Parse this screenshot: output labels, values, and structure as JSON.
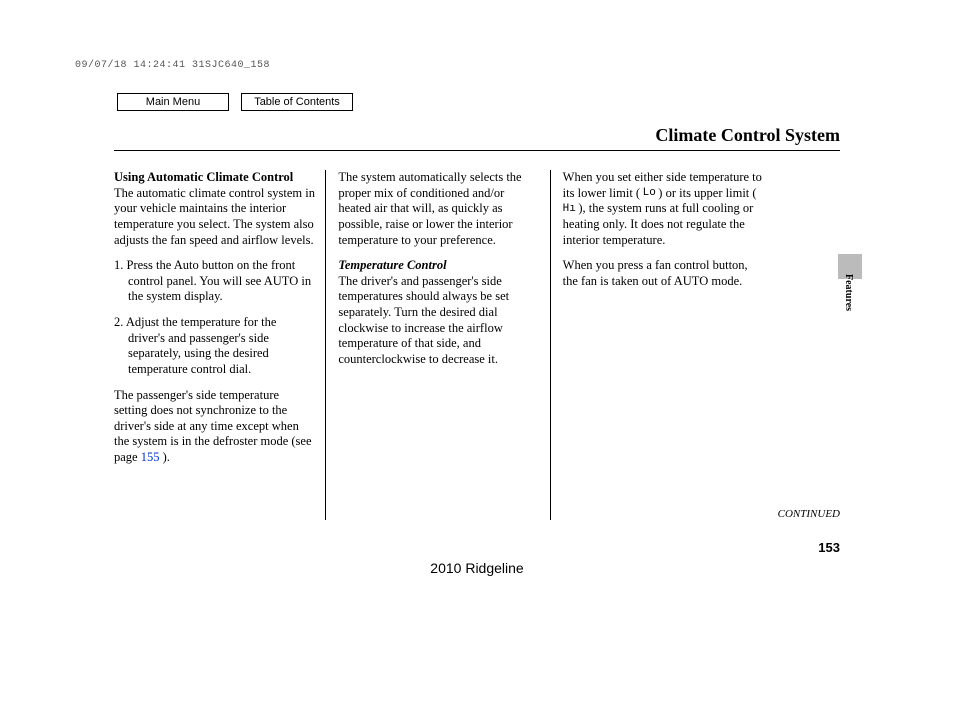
{
  "header_stamp": "09/07/18 14:24:41 31SJC640_158",
  "nav": {
    "main_menu": "Main Menu",
    "toc": "Table of Contents"
  },
  "title": "Climate Control System",
  "col1": {
    "lead_bold": "Using Automatic Climate Control",
    "lead_text": "The automatic climate control system in your vehicle maintains the interior temperature you select. The system also adjusts the fan speed and airflow levels.",
    "step1_prefix": "1. ",
    "step1": "Press the Auto button on the front control panel. You will see AUTO in the system display.",
    "step2_prefix": "2. ",
    "step2": "Adjust the temperature for the driver's and passenger's side separately, using the desired temperature control dial.",
    "para2a": "The passenger's side temperature setting does not synchronize to the driver's side at any time except when the system is in the defroster mode (see page ",
    "para2_link": "155",
    "para2b": " )."
  },
  "col2": {
    "para1": "The system automatically selects the proper mix of conditioned and/or heated air that will, as quickly as possible, raise or lower the interior temperature to your preference.",
    "sub_italic": "Temperature Control",
    "para2": "The driver's and passenger's side temperatures should always be set separately. Turn the desired dial clockwise to increase the airflow temperature of that side, and counterclockwise to decrease it."
  },
  "col3": {
    "p1a": "When you set either side temperature to its lower limit ( ",
    "lo_glyph": "Lo",
    "p1b": " ) or its upper limit ( ",
    "hi_glyph": "Hı",
    "p1c": " ), the system runs at full cooling or heating only. It does not regulate the interior temperature.",
    "p2": "When you press a fan control button, the fan is taken out of AUTO mode."
  },
  "side_label": "Features",
  "continued": "CONTINUED",
  "page_number": "153",
  "footer_model": "2010 Ridgeline"
}
